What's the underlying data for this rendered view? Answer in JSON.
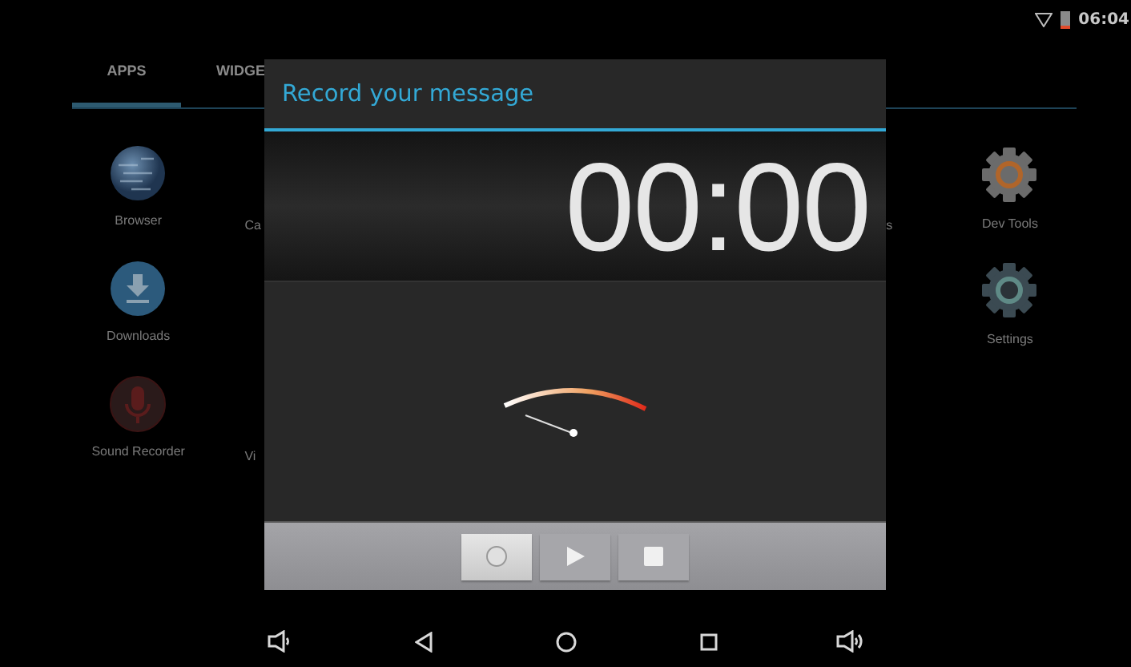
{
  "status_bar": {
    "time": "06:04"
  },
  "launcher": {
    "tabs": [
      {
        "label": "APPS",
        "selected": true
      },
      {
        "label": "WIDGE",
        "selected": false
      }
    ],
    "rows": [
      {
        "left": [
          {
            "label": "Browser",
            "kind": "globe"
          },
          {
            "label": "Ca",
            "kind": "partial"
          }
        ],
        "right": [
          {
            "label": "s",
            "kind": "partial"
          },
          {
            "label": "Dev Tools",
            "kind": "dev-gear"
          }
        ]
      },
      {
        "left": [
          {
            "label": "Downloads",
            "kind": "download"
          }
        ],
        "right": [
          {
            "label": "Settings",
            "kind": "gear"
          }
        ]
      },
      {
        "left": [
          {
            "label": "Sound Recorder",
            "kind": "mic"
          },
          {
            "label": "Vi",
            "kind": "partial"
          }
        ]
      }
    ]
  },
  "dialog": {
    "title": "Record your message",
    "timer": "00:00",
    "controls": [
      {
        "kind": "record",
        "selected": true
      },
      {
        "kind": "play",
        "selected": false
      },
      {
        "kind": "stop",
        "selected": false
      }
    ]
  },
  "nav_bar": {
    "buttons": [
      {
        "kind": "volume-down"
      },
      {
        "kind": "back"
      },
      {
        "kind": "home"
      },
      {
        "kind": "recents"
      },
      {
        "kind": "volume-up"
      }
    ]
  }
}
